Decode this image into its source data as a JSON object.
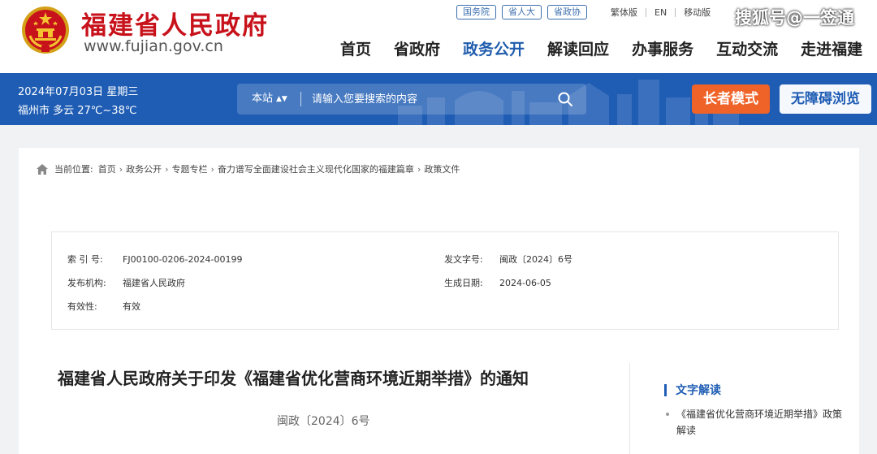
{
  "header": {
    "site_name": "福建省人民政府",
    "site_url": "www.fujian.gov.cn",
    "quick_links": [
      "国务院",
      "省人大",
      "省政协"
    ],
    "lang_links": [
      "繁体版",
      "EN",
      "移动版"
    ],
    "watermark": "搜狐号@一签通"
  },
  "nav": {
    "items": [
      "首页",
      "省政府",
      "政务公开",
      "解读回应",
      "办事服务",
      "互动交流",
      "走进福建"
    ],
    "active_index": 2
  },
  "band": {
    "date": "2024年07月03日",
    "weekday": "星期三",
    "weather": "福州市 多云 27℃~38℃",
    "search_scope": "本站",
    "search_placeholder": "请输入您要搜索的内容",
    "elder_mode": "长者模式",
    "accessible": "无障碍浏览"
  },
  "breadcrumb": {
    "label": "当前位置:",
    "items": [
      "首页",
      "政务公开",
      "专题专栏",
      "奋力谱写全面建设社会主义现代化国家的福建篇章",
      "政策文件"
    ]
  },
  "doc_info": {
    "index_label": "索 引 号:",
    "index_value": "FJ00100-0206-2024-00199",
    "issuer_label": "发布机构:",
    "issuer_value": "福建省人民政府",
    "validity_label": "有效性:",
    "validity_value": "有效",
    "docno_label": "发文字号:",
    "docno_value": "闽政〔2024〕6号",
    "date_label": "生成日期:",
    "date_value": "2024-06-05"
  },
  "document": {
    "title": "福建省人民政府关于印发《福建省优化营商环境近期举措》的通知",
    "number": "闽政〔2024〕6号"
  },
  "sidebar": {
    "title": "文字解读",
    "items": [
      "《福建省优化营商环境近期举措》政策解读"
    ]
  },
  "colors": {
    "brand_red": "#c8121b",
    "brand_blue": "#1f5db4",
    "elder_orange": "#ef6328"
  }
}
